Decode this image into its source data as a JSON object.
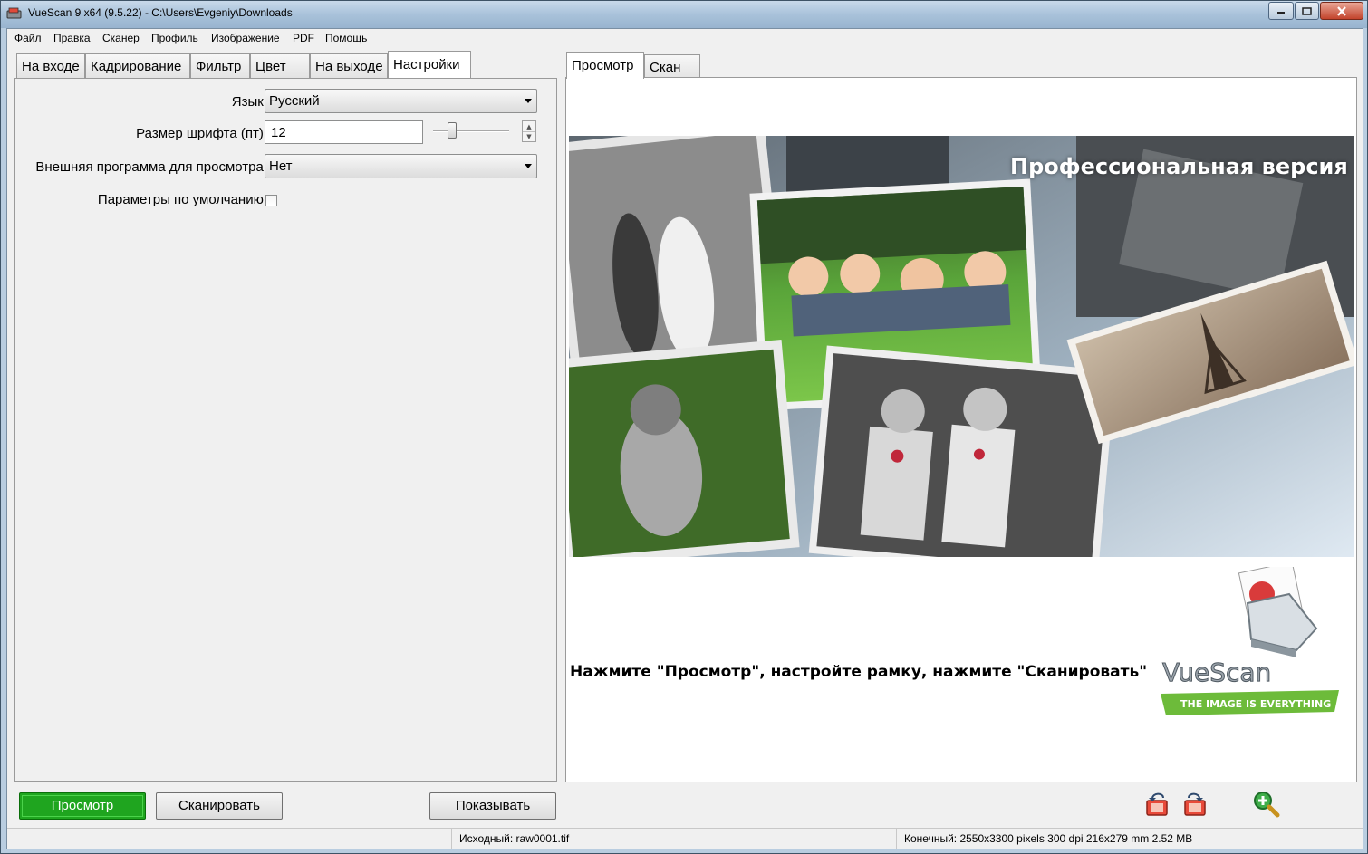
{
  "window": {
    "title": "VueScan 9 x64 (9.5.22) - C:\\Users\\Evgeniy\\Downloads"
  },
  "menu": [
    "Файл",
    "Правка",
    "Сканер",
    "Профиль",
    "Изображение",
    "PDF",
    "Помощь"
  ],
  "left_tabs": [
    "На входе",
    "Кадрирование",
    "Фильтр",
    "Цвет",
    "На выходе",
    "Настройки"
  ],
  "active_left_tab": "Настройки",
  "settings": {
    "language_label": "Язык:",
    "language_value": "Русский",
    "font_size_label": "Размер шрифта (пт):",
    "font_size_value": "12",
    "font_size_slider": 0.25,
    "viewer_label": "Внешняя программа для просмотра:",
    "viewer_value": "Нет",
    "defaults_label": "Параметры по умолчанию:",
    "defaults_checked": false
  },
  "right_tabs": [
    "Просмотр",
    "Скан"
  ],
  "active_right_tab": "Просмотр",
  "preview": {
    "banner_title": "Профессиональная версия",
    "instruction": "Нажмите \"Просмотр\", настройте рамку, нажмите \"Сканировать\"",
    "logo_text": "VueScan",
    "logo_tagline": "THE IMAGE IS EVERYTHING"
  },
  "buttons": {
    "preview": "Просмотр",
    "scan": "Сканировать",
    "show": "Показывать"
  },
  "toolbar_icons": [
    "rotate-left-icon",
    "rotate-right-icon",
    "zoom-in-icon"
  ],
  "status": {
    "source": "Исходный: raw0001.tif",
    "output": "Конечный: 2550x3300 pixels 300 dpi 216x279 mm 2.52 MB"
  },
  "colors": {
    "preview_button": "#1fa51f",
    "titlebar": "#a9c2da",
    "logo_green": "#6dbb3a"
  }
}
